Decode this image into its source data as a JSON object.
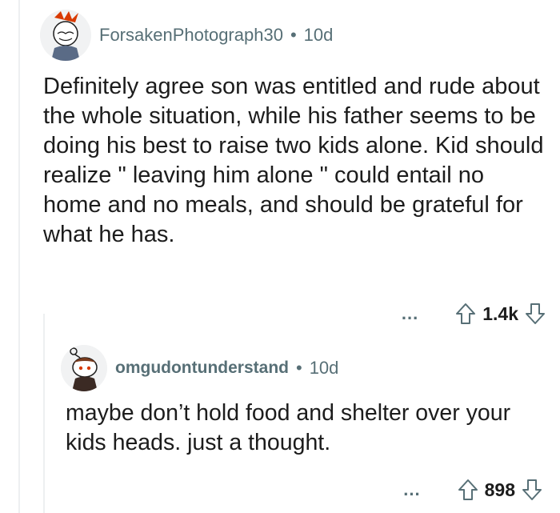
{
  "comments": [
    {
      "username": "ForsakenPhotograph30",
      "separator": "•",
      "age": "10d",
      "body": "Definitely agree son was entitled and rude about the whole situation, while his father seems to be doing his best to raise two kids alone. Kid should realize \" leaving him alone \" could entail no home and no meals, and should be grateful for what he has.",
      "more": "...",
      "score": "1.4k"
    },
    {
      "username": "omgudontunderstand",
      "separator": "•",
      "age": "10d",
      "body": "maybe don’t hold food and shelter over your kids heads. just a thought.",
      "more": "...",
      "score": "898"
    }
  ],
  "colors": {
    "meta": "#576f76",
    "text": "#1c1c1c",
    "thread_line": "#edeff1"
  },
  "icons": [
    "avatar-icon",
    "upvote-icon",
    "downvote-icon",
    "more-options-icon"
  ]
}
